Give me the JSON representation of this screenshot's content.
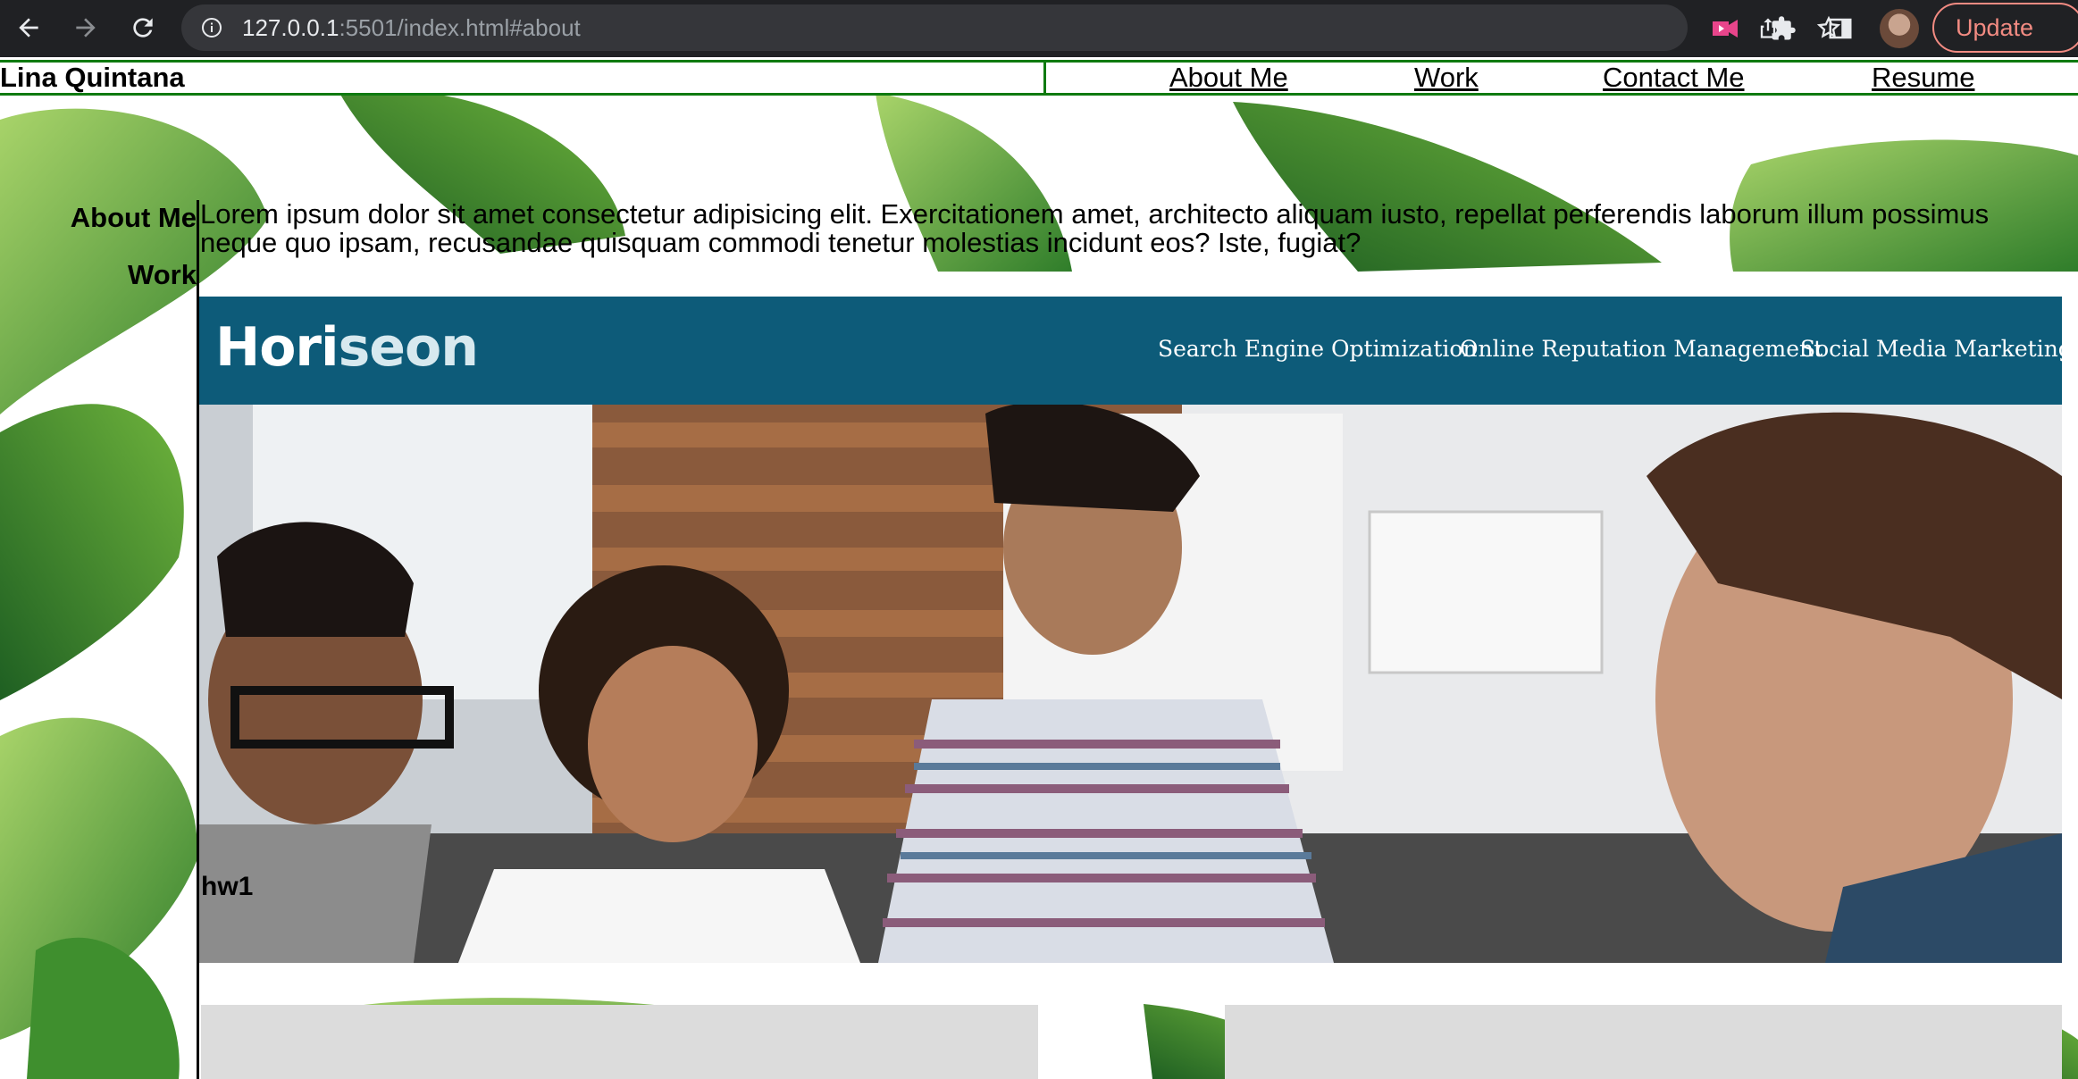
{
  "browser": {
    "url_host": "127.0.0.1",
    "url_rest": ":5501/index.html#about",
    "update_label": "Update"
  },
  "site": {
    "brand": "Lina Quintana",
    "nav": [
      "About Me",
      "Work",
      "Contact Me",
      "Resume"
    ],
    "side_links": [
      "About Me",
      "Work"
    ],
    "about_text": "Lorem ipsum dolor sit amet consectetur adipisicing elit. Exercitationem amet, architecto aliquam iusto, repellat perferendis laborum illum possimus neque quo ipsam, recusandae quisquam commodi tenetur molestias incidunt eos? Iste, fugiat?"
  },
  "project": {
    "logo_main": "Hori",
    "logo_light": "seon",
    "nav": [
      "Search Engine Optimization",
      "Online Reputation Management",
      "Social Media Marketing"
    ],
    "label": "hw1"
  },
  "colors": {
    "header_border": "#0f7a10",
    "horiseon_header": "#0d5b79",
    "chrome_bg": "#202124",
    "update_accent": "#f28b82"
  }
}
